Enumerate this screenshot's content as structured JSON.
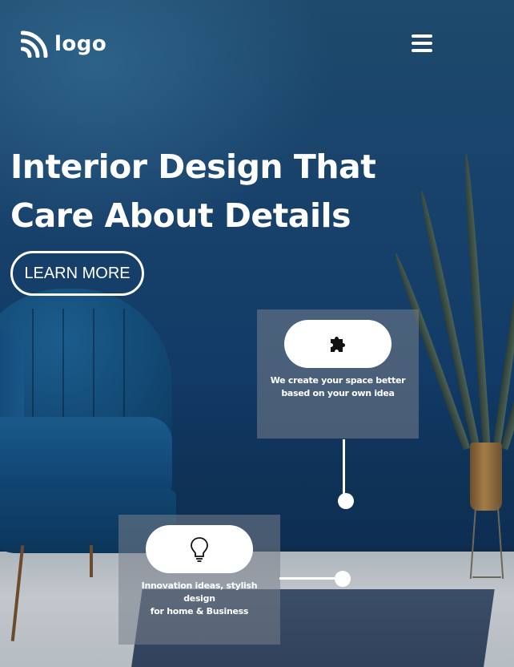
{
  "header": {
    "logo_text": "logo",
    "logo_icon": "rss-arc-icon",
    "menu_icon": "hamburger-menu-icon"
  },
  "hero": {
    "headline": "Interior Design That Care About Details",
    "cta_label": "LEARN MORE"
  },
  "cards": [
    {
      "icon": "puzzle-piece-icon",
      "text": "We create your space better\nbased on your own idea"
    },
    {
      "icon": "lightbulb-icon",
      "text": "Innovation ideas, stylish\ndesign\nfor home & Business"
    }
  ],
  "colors": {
    "background": "#17406a",
    "text": "#ffffff",
    "card": "#78808a"
  }
}
